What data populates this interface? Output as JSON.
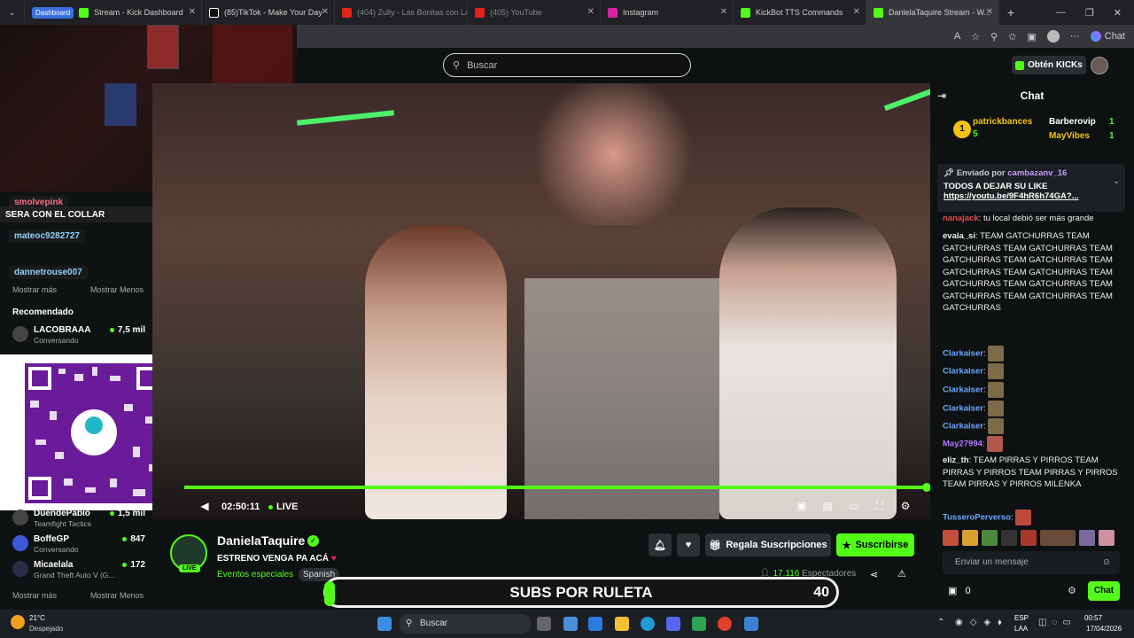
{
  "browser": {
    "tabs": [
      {
        "badge": "Dashboard",
        "label": "Stream - Kick Dashboard",
        "icon_color": "#53fc18"
      },
      {
        "label": "(85)TikTok - Make Your Day",
        "icon_color": "#ffffff"
      },
      {
        "label": "(404) Zully - Las Bonitas con La...",
        "icon_color": "#e62117"
      },
      {
        "label": "(405) YouTube",
        "icon_color": "#e62117"
      },
      {
        "label": "Instagram",
        "icon_color": "#d6249f"
      },
      {
        "label": "KickBot TTS Commands",
        "icon_color": "#53fc18"
      },
      {
        "label": "DanielaTaquire Stream - W...",
        "icon_color": "#53fc18"
      }
    ],
    "toolbar_chat": "Chat"
  },
  "site": {
    "search_placeholder": "Buscar",
    "get_kicks": "Obtén KICKs"
  },
  "left": {
    "overlay_lines": [
      {
        "user": "smolvepink"
      },
      {
        "text": "SERA CON EL COLLAR"
      },
      {
        "user": "mateoc9282727"
      },
      {
        "user": "dannetrouse007"
      }
    ],
    "show_more": "Mostrar más",
    "show_less": "Mostrar Menos",
    "recommended_title": "Recomendado",
    "recommended": [
      {
        "name": "LACOBRAAA",
        "sub": "Conversando",
        "viewers": "7,5 mil"
      }
    ],
    "recommended_bottom": [
      {
        "name": "DuendePablo",
        "sub": "Teamfight Tactics",
        "viewers": "1,5 mil"
      },
      {
        "name": "BoffeGP",
        "sub": "Conversando",
        "viewers": "847"
      },
      {
        "name": "Micaelala",
        "sub": "Grand Theft Auto V (G...",
        "viewers": "172"
      }
    ],
    "show_more2": "Mostrar más",
    "show_less2": "Mostrar Menos"
  },
  "player": {
    "time": "02:50:11",
    "live": "LIVE",
    "progress": 1.0
  },
  "stream": {
    "name": "DanielaTaquire",
    "live_badge": "LIVE",
    "title": "ESTRENO VENGA PA ACÁ",
    "category": "Eventos especiales",
    "language": "Spanish",
    "gift_subs": "Regala Suscripciones",
    "subscribe": "Suscribirse",
    "viewers": "17.116",
    "viewers_label": "Espectadores"
  },
  "banner": {
    "text": "SUBS POR RULETA",
    "number": "40"
  },
  "chat": {
    "title": "Chat",
    "gifters": [
      {
        "rank": "1",
        "name": "patrickbances",
        "count": "5"
      },
      {
        "name": "Barberovip",
        "count": "1"
      },
      {
        "name": "MayVibes",
        "count": "1"
      }
    ],
    "pinned": {
      "sent_by": "Enviado por",
      "user": "cambazanv_16",
      "line1": "TODOS A DEJAR SU LIKE",
      "link": "https://youtu.be/9F4hR6h74GA?..."
    },
    "messages": [
      {
        "user": "nanajack",
        "text": ": tu local debió ser más grande",
        "color": "#e04b4b"
      },
      {
        "user": "evala_si",
        "text": ": TEAM GATCHURRAS TEAM GATCHURRAS TEAM GATCHURRAS TEAM GATCHURRAS TEAM GATCHURRAS TEAM GATCHURRAS TEAM GATCHURRAS TEAM GATCHURRAS TEAM GATCHURRAS TEAM GATCHURRAS TEAM GATCHURRAS TEAM GATCHURRAS",
        "color": "#ffffff"
      },
      {
        "user": "Clarkaiser",
        "text": ":",
        "color": "#6aa8ff"
      },
      {
        "user": "Clarkaiser",
        "text": ":",
        "color": "#6aa8ff"
      },
      {
        "user": "Clarkaiser",
        "text": ":",
        "color": "#6aa8ff"
      },
      {
        "user": "Clarkaiser",
        "text": ":",
        "color": "#6aa8ff"
      },
      {
        "user": "Clarkaiser",
        "text": ":",
        "color": "#6aa8ff"
      },
      {
        "user": "May27994",
        "text": ":",
        "color": "#b57bff"
      },
      {
        "user": "eliz_th",
        "text": ": TEAM PIRRAS Y PIRROS TEAM PIRRAS Y PIRROS TEAM PIRRAS Y PIRROS TEAM PIRRAS Y PIRROS MILENKA",
        "color": "#ffffff"
      },
      {
        "user": "TusseroPerverso",
        "text": ":",
        "color": "#6aa8ff"
      }
    ],
    "input_placeholder": "Enviar un mensaje",
    "kicks_count": "0",
    "send_label": "Chat"
  },
  "taskbar": {
    "weather_temp": "21°C",
    "weather_text": "Despejado",
    "search": "Buscar",
    "lang1": "ESP",
    "lang2": "LAA",
    "time": "00:57",
    "date": "17/04/2026"
  },
  "colors": {
    "kick_green": "#53fc18",
    "bg": "#0e1112"
  }
}
